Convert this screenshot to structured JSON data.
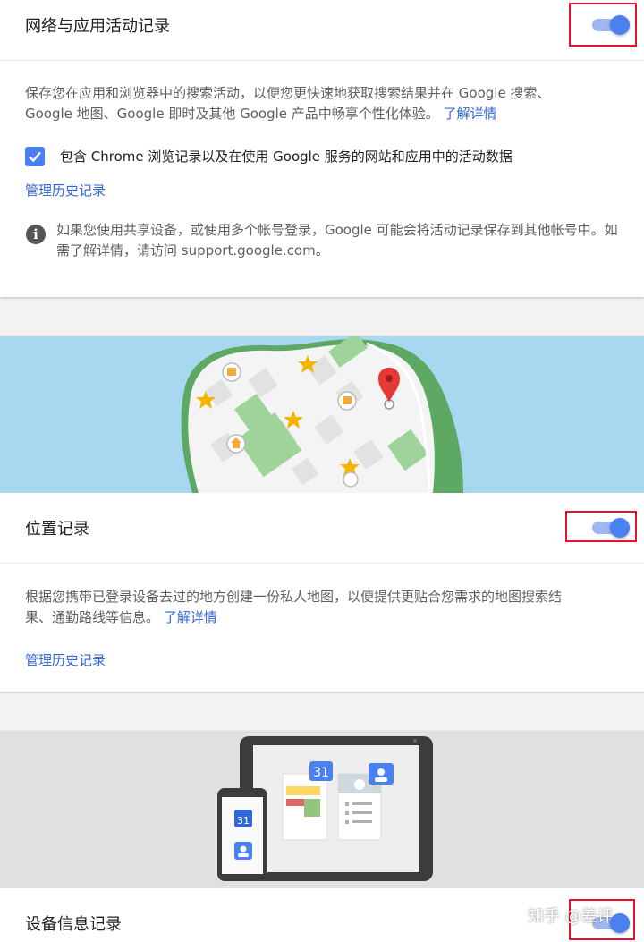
{
  "web_activity": {
    "title": "网络与应用活动记录",
    "toggle_on": true,
    "description": "保存您在应用和浏览器中的搜索活动，以便您更快速地获取搜索结果并在 Google 搜索、Google 地图、Google 即时及其他 Google 产品中畅享个性化体验。",
    "learn_more": "了解详情",
    "checkbox_checked": true,
    "checkbox_label": "包含 Chrome 浏览记录以及在使用 Google 服务的网站和应用中的活动数据",
    "manage": "管理历史记录",
    "info_text": "如果您使用共享设备，或使用多个帐号登录，Google 可能会将活动记录保存到其他帐号中。如需了解详情，请访问 support.google.com。"
  },
  "location": {
    "title": "位置记录",
    "toggle_on": true,
    "description": "根据您携带已登录设备去过的地方创建一份私人地图，以便提供更贴合您需求的地图搜索结果、通勤路线等信息。",
    "learn_more": "了解详情",
    "manage": "管理历史记录"
  },
  "device": {
    "title": "设备信息记录",
    "toggle_on": true,
    "calendar_day": "31"
  },
  "watermark": "知乎 @差评",
  "colors": {
    "accent": "#4a80f0",
    "link": "#3367d6",
    "highlight": "#e8112d",
    "water": "#a8d8f0",
    "park": "#9ed39a"
  }
}
